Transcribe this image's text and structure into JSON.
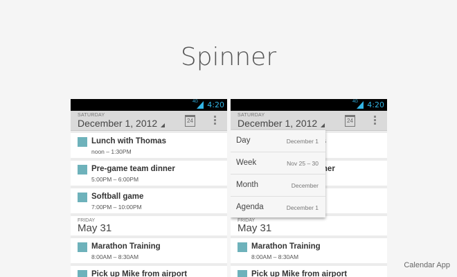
{
  "page": {
    "title": "Spinner",
    "footer": "Calendar App"
  },
  "statusbar": {
    "time": "4:20",
    "network": "4G"
  },
  "actionbar": {
    "day": "SATURDAY",
    "date": "December 1, 2012",
    "calendar_icon_day": "24"
  },
  "events_top": [
    {
      "title": "Lunch with Thomas",
      "time": "noon – 1:30PM"
    },
    {
      "title": "Pre-game team dinner",
      "time": "5:00PM – 6:00PM"
    },
    {
      "title": "Softball game",
      "time": "7:00PM – 10:00PM"
    }
  ],
  "day_header": {
    "day": "FRIDAY",
    "date": "May 31"
  },
  "events_bottom": [
    {
      "title": "Marathon Training",
      "time": "8:00AM – 8:30AM"
    },
    {
      "title": "Pick up Mike from airport",
      "time": ""
    }
  ],
  "spinner_options": [
    {
      "label": "Day",
      "range": "December 1"
    },
    {
      "label": "Week",
      "range": "Nov 25 – 30"
    },
    {
      "label": "Month",
      "range": "December"
    },
    {
      "label": "Agenda",
      "range": "December 1"
    }
  ],
  "colors": {
    "event_marker": "#6eb2bb",
    "status_accent": "#33b5e5"
  }
}
